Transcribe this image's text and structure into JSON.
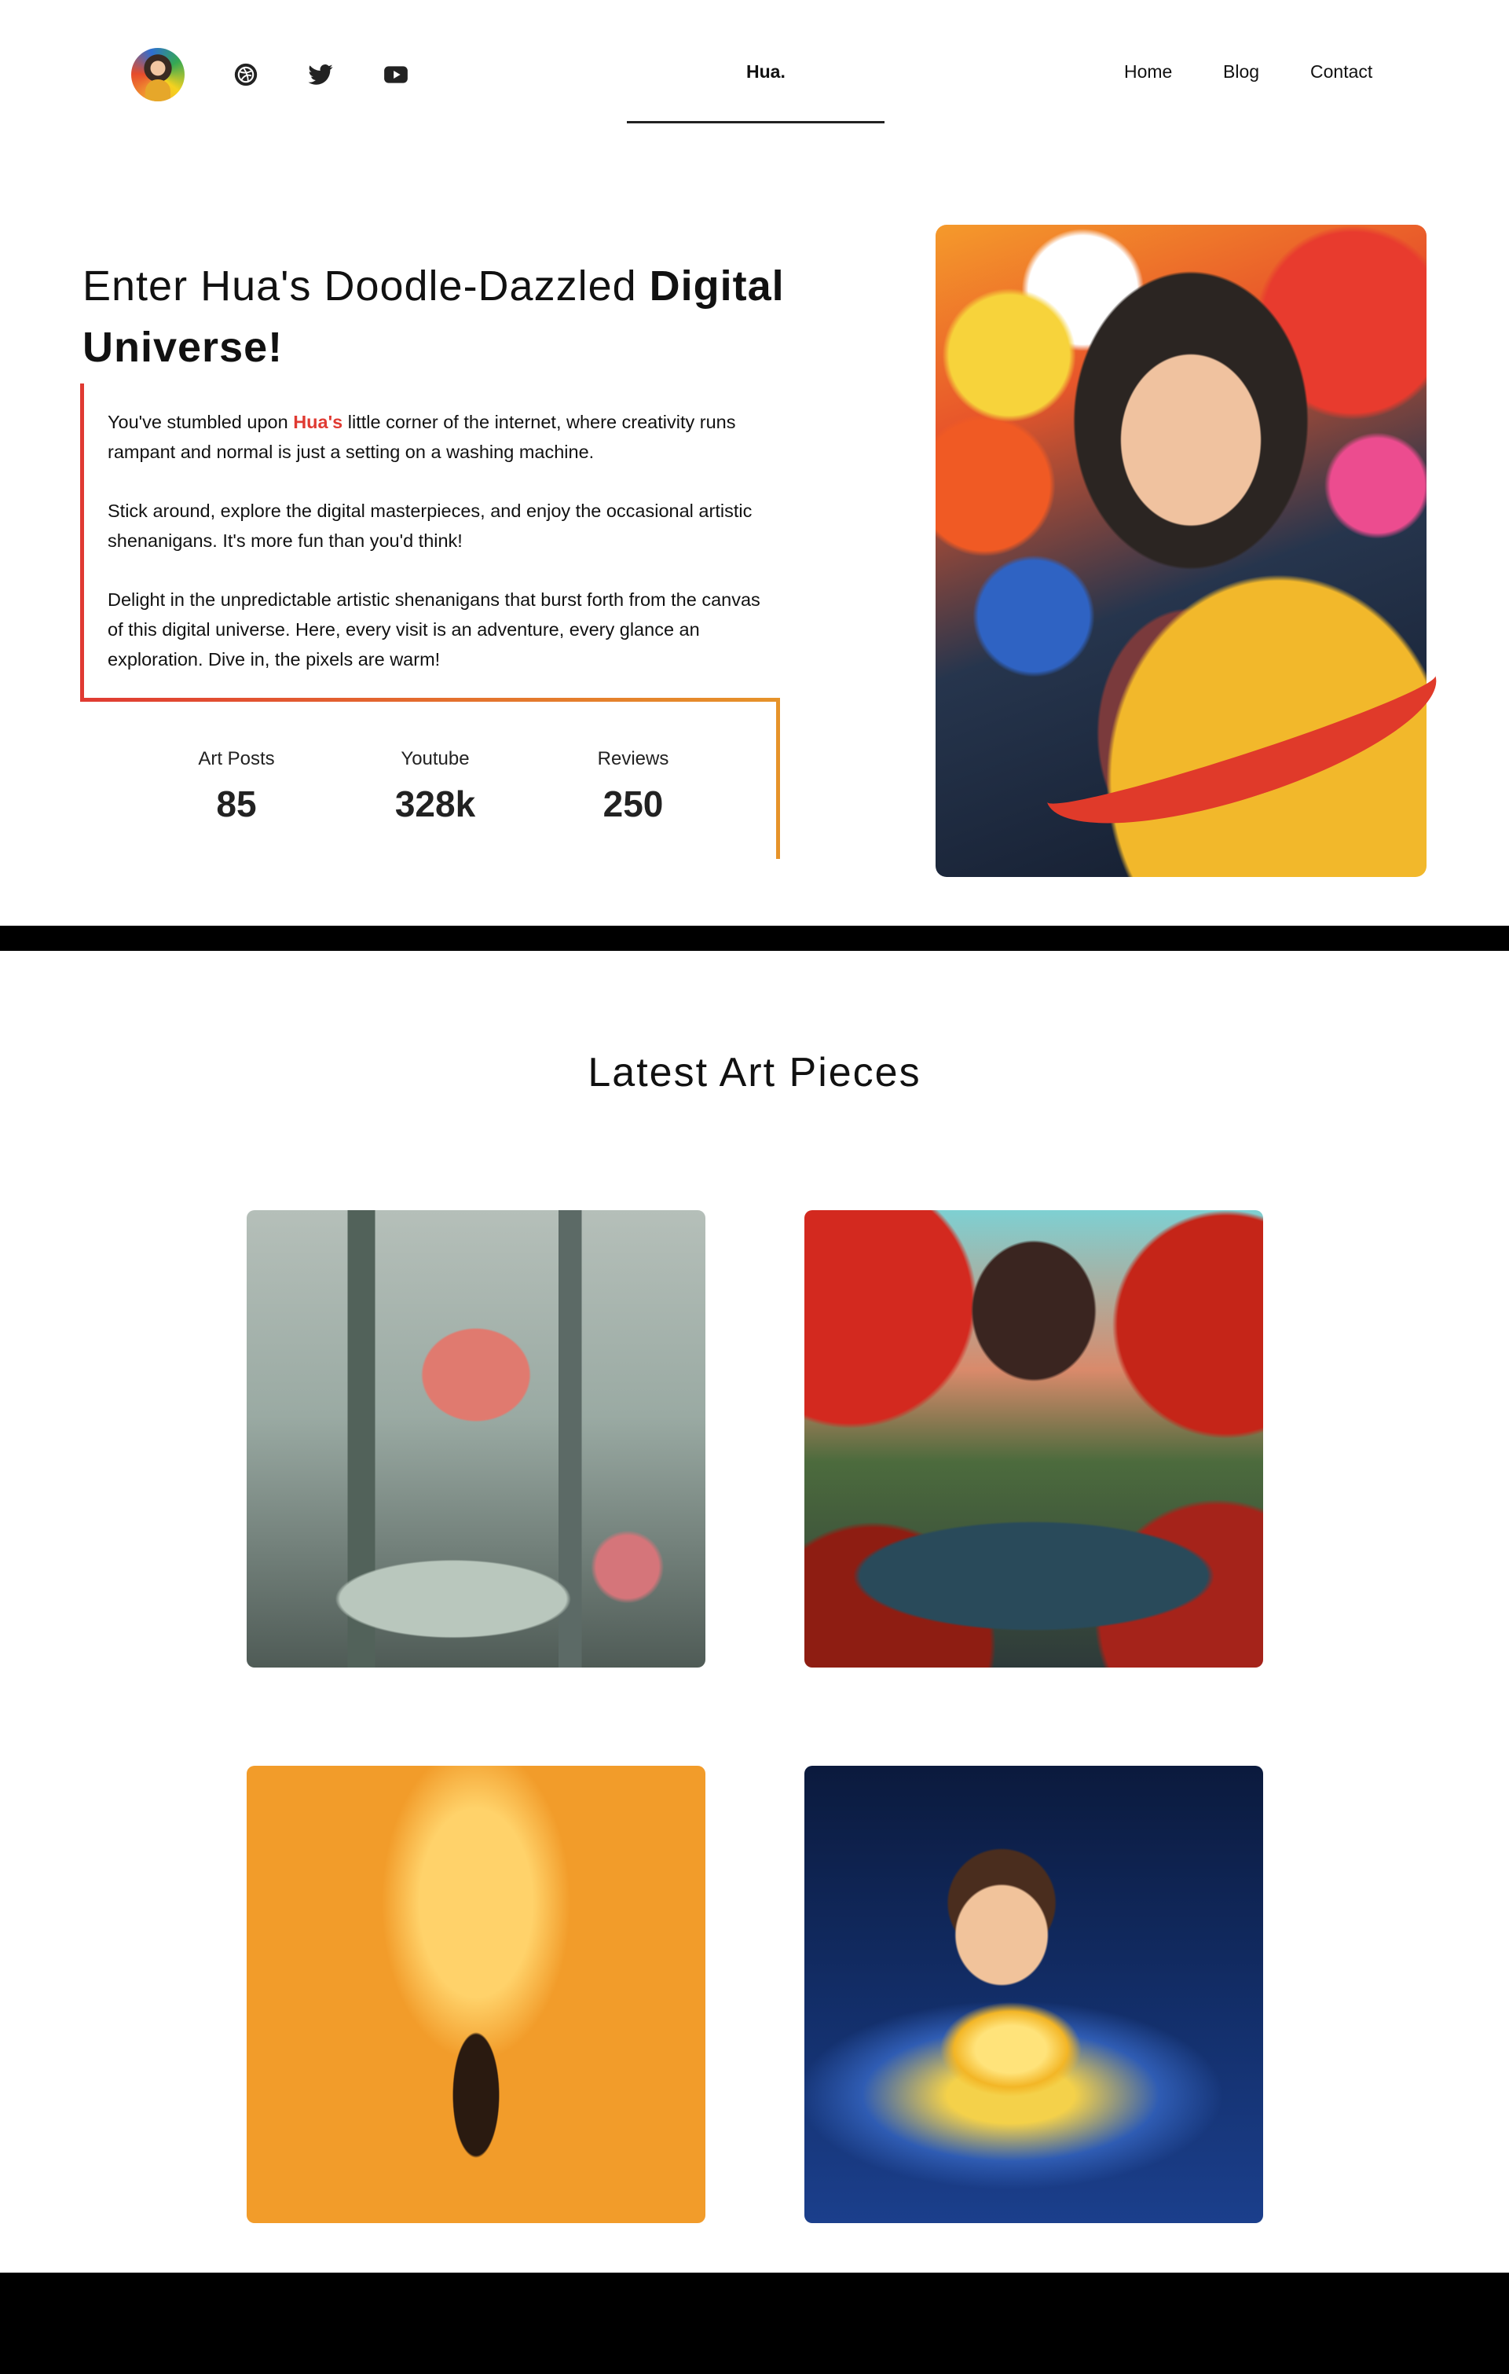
{
  "header": {
    "brand": "Hua.",
    "nav": [
      {
        "label": "Home"
      },
      {
        "label": "Blog"
      },
      {
        "label": "Contact"
      }
    ],
    "social_icons": [
      "dribbble-icon",
      "twitter-icon",
      "youtube-icon"
    ]
  },
  "hero": {
    "title_regular": "Enter Hua's Doodle-Dazzled ",
    "title_bold": "Digital Universe!",
    "p1_before": "You've stumbled upon ",
    "p1_highlight": "Hua's",
    "p1_after": " little corner of the internet, where creativity runs rampant and normal is just a setting on a washing machine.",
    "p2": "Stick around, explore the digital masterpieces, and enjoy the occasional artistic shenanigans. It's more fun than you'd think!",
    "p3": "Delight in the unpredictable artistic shenanigans that burst forth from the canvas of this digital universe. Here, every visit is an adventure, every glance an exploration. Dive in, the pixels are warm!",
    "stats": [
      {
        "label": "Art Posts",
        "value": "85"
      },
      {
        "label": "Youtube",
        "value": "328k"
      },
      {
        "label": "Reviews",
        "value": "250"
      }
    ]
  },
  "gallery": {
    "title": "Latest Art Pieces"
  },
  "colors": {
    "accent_red": "#e03a32",
    "accent_orange": "#e6932a",
    "text": "#111111",
    "bar": "#000000"
  }
}
